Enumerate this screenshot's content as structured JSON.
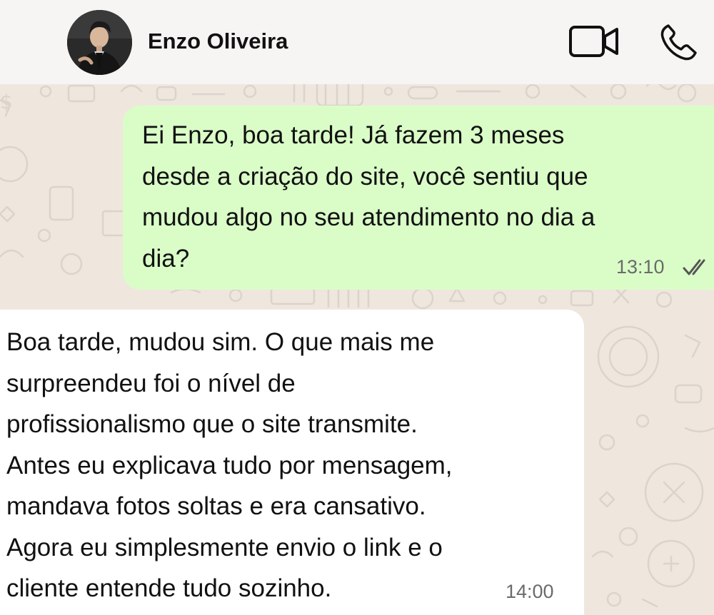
{
  "contact": {
    "name": "Enzo Oliveira"
  },
  "header_icons": {
    "video": "video-camera-icon",
    "voice": "phone-icon"
  },
  "messages": [
    {
      "direction": "outgoing",
      "text": "Ei Enzo, boa tarde! Já fazem 3 meses\ndesde a criação do site, você sentiu que\nmudou algo no seu atendimento no dia a\ndia?",
      "time": "13:10",
      "status_icon": "double-check-read-icon"
    },
    {
      "direction": "incoming",
      "text": "Boa tarde, mudou sim. O que mais me\nsurpreendeu foi o nível de\nprofissionalismo que o site transmite.\nAntes eu explicava tudo por mensagem,\nmandava fotos soltas e era cansativo.\nAgora eu simplesmente envio o link e o\ncliente entende tudo sozinho.",
      "time": "14:00"
    }
  ],
  "colors": {
    "chat_background": "#efe7de",
    "header_background": "#f6f5f3",
    "outgoing_bubble": "#dafdc8",
    "incoming_bubble": "#ffffff",
    "text": "#111111",
    "timestamp": "#6b6b6b"
  }
}
